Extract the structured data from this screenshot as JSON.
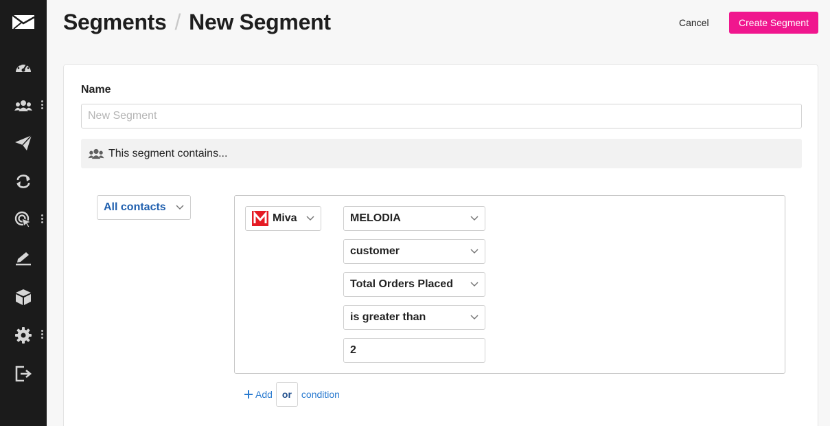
{
  "colors": {
    "sidebar_bg": "#1b1b1b",
    "accent": "#f0168e",
    "link": "#2a7bd0",
    "miva_red": "#e51b24"
  },
  "sidebar": {
    "items": [
      {
        "icon": "envelope-logo-icon"
      },
      {
        "icon": "dashboard-gauge-icon"
      },
      {
        "icon": "contacts-icon",
        "has_menu": true
      },
      {
        "icon": "paper-plane-icon"
      },
      {
        "icon": "automation-loop-icon"
      },
      {
        "icon": "target-cursor-icon",
        "has_menu": true
      },
      {
        "icon": "signup-form-icon"
      },
      {
        "icon": "integrations-box-icon"
      },
      {
        "icon": "settings-gear-icon",
        "has_menu": true
      },
      {
        "icon": "sign-out-icon"
      }
    ]
  },
  "header": {
    "breadcrumb_parent": "Segments",
    "separator": "/",
    "title": "New Segment",
    "cancel_label": "Cancel",
    "create_label": "Create Segment"
  },
  "form": {
    "name_label": "Name",
    "name_placeholder": "New Segment",
    "name_value": "",
    "contains_text": "This segment contains..."
  },
  "conditions": {
    "match_selector": "All contacts",
    "source": "Miva",
    "store": "MELODIA",
    "object": "customer",
    "field": "Total Orders Placed",
    "operator": "is greater than",
    "value": "2"
  },
  "add_condition": {
    "add_label": "Add",
    "or_label": "or",
    "condition_label": "condition"
  }
}
